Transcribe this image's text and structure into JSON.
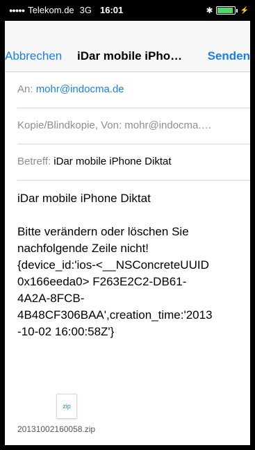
{
  "status_bar": {
    "signal_dots": "●●●●●",
    "carrier": "Telekom.de",
    "network": "3G",
    "time": "16:01",
    "bluetooth_glyph": "✱",
    "battery_level": 0.88,
    "battery_color": "#4cd964"
  },
  "nav": {
    "cancel_label": "Abbrechen",
    "title": "iDar mobile iPho…",
    "send_label": "Senden"
  },
  "fields": {
    "to_label": "An:",
    "to_value": "mohr@indocma.de",
    "cc_label": "Kopie/Blindkopie, Von:",
    "cc_value": "mohr@indocma.…",
    "subject_label": "Betreff:",
    "subject_value": "iDar mobile iPhone Diktat"
  },
  "body": {
    "line1": "iDar mobile iPhone Diktat",
    "paragraph": "Bitte verändern oder löschen Sie nachfolgende Zeile nicht!",
    "device_line": "{device_id:'ios-<__NSConcreteUUID\n0x166eeda0> F263E2C2-DB61-\n4A2A-8FCB-\n4B48CF306BAA',creation_time:'2013\n-10-02 16:00:58Z'}"
  },
  "attachment": {
    "icon_label": "zip",
    "file_name": "20131002160058.zip"
  },
  "colors": {
    "accent": "#1a7fe9",
    "label_grey": "#8e8e93"
  }
}
